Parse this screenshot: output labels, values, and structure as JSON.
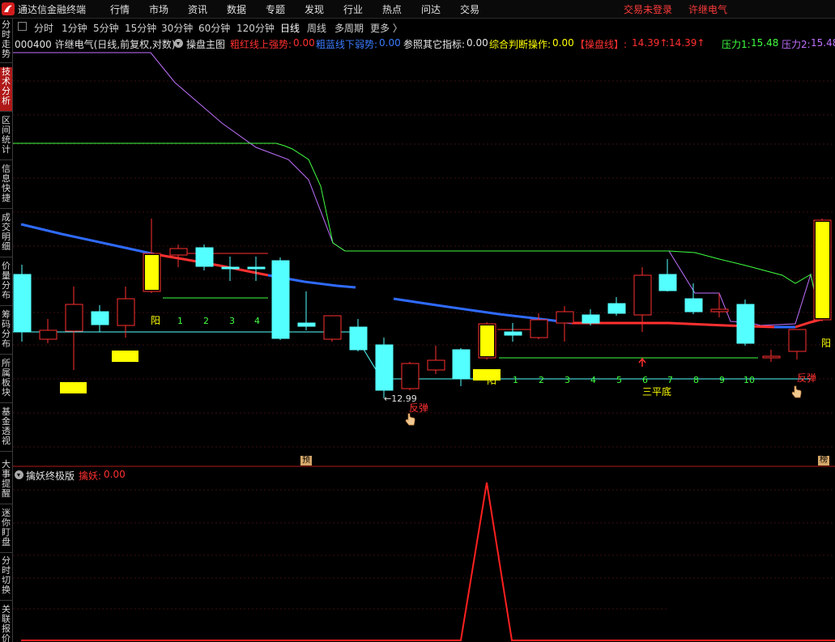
{
  "app": {
    "title": "通达信金融终端"
  },
  "menu": [
    "行情",
    "市场",
    "资讯",
    "数据",
    "专题",
    "发现",
    "行业",
    "热点",
    "问达",
    "交易"
  ],
  "status": {
    "trade": "交易未登录",
    "stock": "许继电气"
  },
  "sidebar": [
    "分时走势",
    "技术分析",
    "区间统计",
    "信息快捷",
    "成交明细",
    "价量分布",
    "筹码分布",
    "所属板块",
    "基金透视",
    "大事提醒",
    "迷你盯盘",
    "分时切换",
    "关联报价"
  ],
  "periods": [
    "分时",
    "1分钟",
    "5分钟",
    "15分钟",
    "30分钟",
    "60分钟",
    "120分钟",
    "日线",
    "周线",
    "多周期",
    "更多 〉"
  ],
  "infobar": {
    "title": "000400 许继电气(日线,前复权,对数)",
    "indicator": "操盘主图",
    "items": [
      {
        "label": "粗红线上强势:",
        "value": "0.00",
        "color": "#ff3030"
      },
      {
        "label": "粗蓝线下弱势:",
        "value": "0.00",
        "color": "#3a7bff"
      },
      {
        "label": "参照其它指标:",
        "value": "0.00",
        "color": "#e8e8e8"
      },
      {
        "label": "综合判断操作:",
        "value": "0.00",
        "color": "#ffff00"
      },
      {
        "label": "【操盘线】:",
        "value": "14.39↑",
        "extra": ":14.39↑",
        "color": "#ff3030"
      },
      {
        "label": "压力1:",
        "value": "15.48",
        "color": "#40ff40"
      },
      {
        "label": "压力2:",
        "value": "15.48",
        "color": "#c070ff"
      }
    ]
  },
  "main_chart": {
    "annotations": {
      "yang_left": "阳",
      "yang_mid": "阳",
      "yang_right": "阳",
      "bounce_left": "反弹",
      "bounce_right": "反弹",
      "low_price": "←12.99",
      "triple_bottom": "三平底",
      "tag_left": "预",
      "tag_right": "榜"
    },
    "counts_left": [
      "1",
      "2",
      "3",
      "4"
    ],
    "counts_right": [
      "1",
      "2",
      "3",
      "4",
      "5",
      "6",
      "7",
      "8",
      "9",
      "10"
    ]
  },
  "sub_chart": {
    "indicator": "擒妖终极版",
    "label": "擒妖:",
    "value": "0.00"
  },
  "colors": {
    "up": "#ff3030",
    "down": "#54ffff",
    "yellow": "#ffff00",
    "blue": "#2f6bff",
    "green": "#40ff40",
    "purple": "#c070ff"
  },
  "icons": [
    "dropdown-icon",
    "hand-pointer-icon",
    "up-arrow-icon",
    "logo-icon"
  ]
}
